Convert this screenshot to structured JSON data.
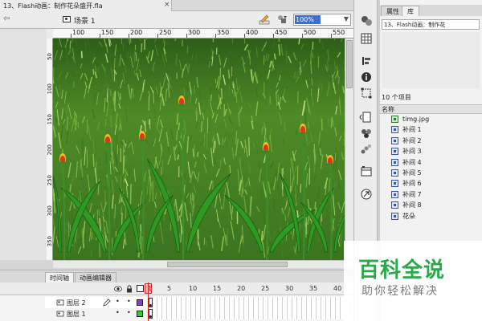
{
  "document": {
    "tab_title": "13、Flash动画：制作花朵盛开.fla",
    "close_symbol": "×"
  },
  "scene_bar": {
    "back_symbol": "⇦",
    "scene_label": "场景 1",
    "zoom_value": "100%",
    "zoom_arrow": "▼"
  },
  "rulers": {
    "top_labels": [
      "100",
      "150",
      "200",
      "250",
      "300",
      "350",
      "400",
      "450",
      "500",
      "550"
    ],
    "left_labels": [
      "50",
      "100",
      "150",
      "200",
      "250",
      "300",
      "350"
    ]
  },
  "timeline": {
    "tabs": [
      "时间轴",
      "动画编辑器"
    ],
    "frame_numbers": [
      "1",
      "5",
      "10",
      "15",
      "20",
      "25",
      "30",
      "35",
      "40"
    ],
    "layers": [
      {
        "name": "图层 2",
        "visible_dot": "•",
        "lock_dot": "•",
        "color": "#8a3cc8"
      },
      {
        "name": "图层 1",
        "visible_dot": "•",
        "lock_dot": "•",
        "color": "#2ad32a"
      }
    ]
  },
  "library": {
    "tabs": [
      "属性",
      "库"
    ],
    "document_name": "13、Flash动画：制作花",
    "item_count": "10 个项目",
    "column_name": "名称",
    "items": [
      {
        "name": "timg.jpg",
        "type": "bitmap"
      },
      {
        "name": "补间 1",
        "type": "graphic"
      },
      {
        "name": "补间 2",
        "type": "graphic"
      },
      {
        "name": "补间 3",
        "type": "graphic"
      },
      {
        "name": "补间 4",
        "type": "graphic"
      },
      {
        "name": "补间 5",
        "type": "graphic"
      },
      {
        "name": "补间 6",
        "type": "graphic"
      },
      {
        "name": "补间 7",
        "type": "graphic"
      },
      {
        "name": "补间 8",
        "type": "graphic"
      },
      {
        "name": "花朵",
        "type": "graphic"
      }
    ]
  },
  "watermark": {
    "title": "百科全说",
    "subtitle": "助你轻松解决"
  },
  "colors": {
    "selection": "#3a6fd8",
    "playhead": "#e02020",
    "grass_dark": "#2f6b1c",
    "grass_light": "#8cc34a",
    "bud_red": "#d8381e",
    "bud_yellow": "#f2c21a"
  }
}
